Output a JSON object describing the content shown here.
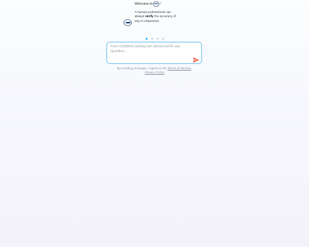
{
  "onboarding": {
    "welcome_text": "Welcome to",
    "welcome_suffix": "!",
    "slide_text_before": "A human professional can always",
    "slide_text_bold": "verify",
    "slide_text_after": "the accuracy of any AI responses.",
    "dots_total": 4,
    "active_dot_index": 0
  },
  "chat": {
    "placeholder": "Feel confident asking our advanced AI any question...",
    "value": ""
  },
  "terms": {
    "prefix": "By sending message, I agree to the",
    "terms_link": "Terms of Service",
    "separator": ",",
    "privacy_link": "Privacy Policy"
  },
  "colors": {
    "accent": "#34b6e8",
    "send": "#f06a55",
    "input_border": "#7cc8ee"
  },
  "icons": {
    "logo": "brand-logo-icon",
    "send": "send-icon"
  }
}
